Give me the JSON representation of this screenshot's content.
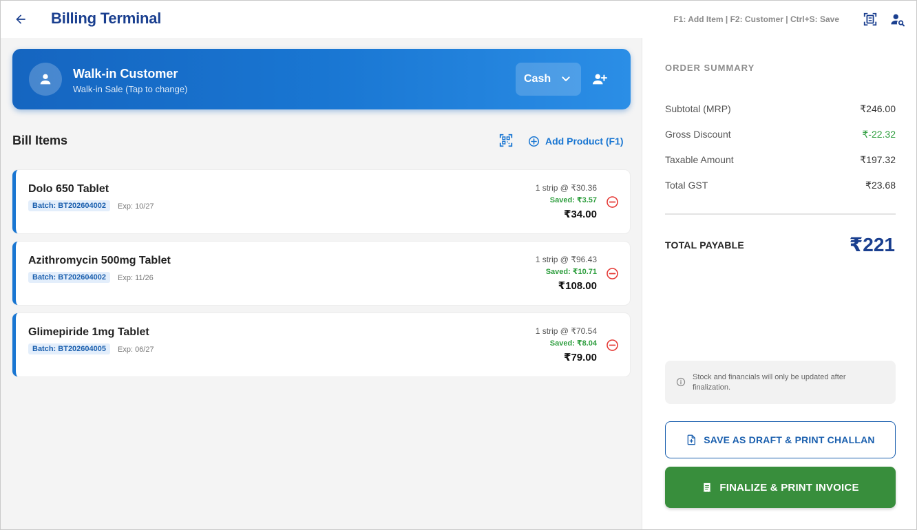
{
  "header": {
    "title": "Billing Terminal",
    "shortcuts": "F1: Add Item | F2: Customer | Ctrl+S: Save"
  },
  "customer": {
    "name": "Walk-in Customer",
    "subtitle": "Walk-in Sale (Tap to change)",
    "payment_mode": "Cash"
  },
  "bill": {
    "title": "Bill Items",
    "add_product_label": "Add Product (F1)",
    "items": [
      {
        "name": "Dolo 650 Tablet",
        "batch": "Batch: BT202604002",
        "exp": "Exp: 10/27",
        "rate": "1 strip @ ₹30.36",
        "saved": "Saved: ₹3.57",
        "amount": "₹34.00"
      },
      {
        "name": "Azithromycin 500mg Tablet",
        "batch": "Batch: BT202604002",
        "exp": "Exp: 11/26",
        "rate": "1 strip @ ₹96.43",
        "saved": "Saved: ₹10.71",
        "amount": "₹108.00"
      },
      {
        "name": "Glimepiride 1mg Tablet",
        "batch": "Batch: BT202604005",
        "exp": "Exp: 06/27",
        "rate": "1 strip @ ₹70.54",
        "saved": "Saved: ₹8.04",
        "amount": "₹79.00"
      }
    ]
  },
  "summary": {
    "title": "ORDER SUMMARY",
    "rows": [
      {
        "label": "Subtotal (MRP)",
        "value": "₹246.00"
      },
      {
        "label": "Gross Discount",
        "value": "₹-22.32"
      },
      {
        "label": "Taxable Amount",
        "value": "₹197.32"
      },
      {
        "label": "Total GST",
        "value": "₹23.68"
      }
    ],
    "total_label": "TOTAL PAYABLE",
    "total_value": "₹221",
    "notice": "Stock and financials will only be updated after finalization.",
    "draft_button": "SAVE AS DRAFT & PRINT CHALLAN",
    "finalize_button": "FINALIZE & PRINT INVOICE"
  },
  "colors": {
    "brand": "#1a3f8f",
    "accent": "#1976d2",
    "discount": "#2e9e3e",
    "finalize": "#388e3c",
    "remove": "#e53935"
  },
  "icons": {
    "back": "arrow-left-icon",
    "scan_header": "document-scanner-icon",
    "user_search": "user-search-icon",
    "avatar": "person-icon",
    "chevron": "chevron-down-icon",
    "add_customer": "person-add-icon",
    "barcode": "qr-scan-icon",
    "add": "plus-circle-icon",
    "remove": "minus-circle-icon",
    "info": "info-icon",
    "draft": "file-plus-icon",
    "invoice": "receipt-icon"
  }
}
